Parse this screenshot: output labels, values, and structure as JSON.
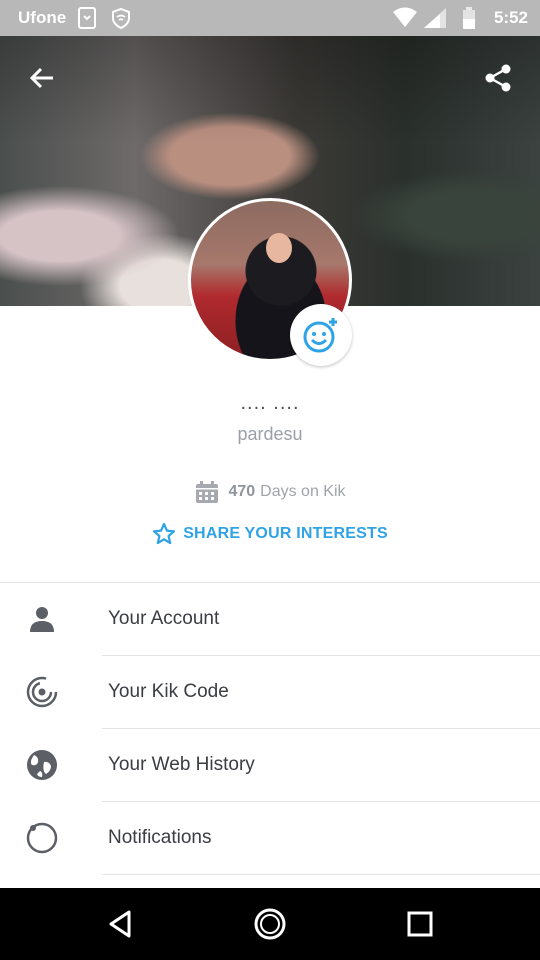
{
  "status_bar": {
    "carrier": "Ufone",
    "time": "5:52"
  },
  "profile": {
    "display_name": ".... ....",
    "username": "pardesu",
    "days_count": "470",
    "days_label": "Days on Kik",
    "share_interests": "SHARE YOUR INTERESTS"
  },
  "menu": {
    "items": [
      {
        "label": "Your Account",
        "icon": "person-icon"
      },
      {
        "label": "Your Kik Code",
        "icon": "kik-code-icon"
      },
      {
        "label": "Your Web History",
        "icon": "globe-icon"
      },
      {
        "label": "Notifications",
        "icon": "notification-ring-icon"
      }
    ]
  },
  "colors": {
    "accent": "#2fa3e6",
    "status_bar": "#b8b8b8",
    "nav_bar": "#000000"
  }
}
